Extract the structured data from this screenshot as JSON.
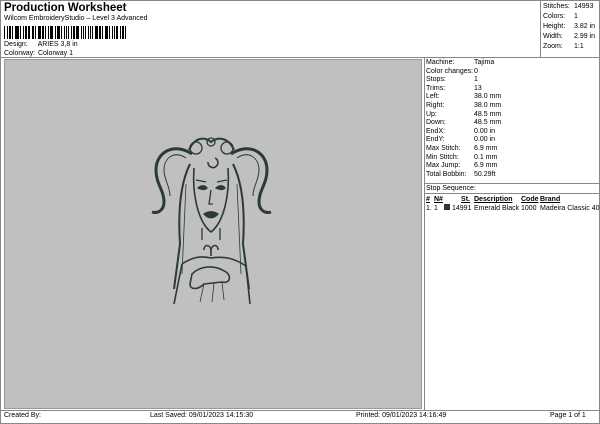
{
  "header": {
    "title": "Production Worksheet",
    "subtitle": "Wilcom EmbroideryStudio – Level 3 Advanced",
    "design_label": "Design:",
    "design_value": "ARIES 3,8 in",
    "colorway_label": "Colorway:",
    "colorway_value": "Colorway 1"
  },
  "summary": [
    {
      "label": "Stitches:",
      "value": "14993"
    },
    {
      "label": "Colors:",
      "value": "1"
    },
    {
      "label": "Height:",
      "value": "3.82 in"
    },
    {
      "label": "Width:",
      "value": "2.99 in"
    },
    {
      "label": "Zoom:",
      "value": "1:1"
    }
  ],
  "details": [
    {
      "label": "Machine:",
      "value": "Tajima"
    },
    {
      "label": "Color changes:",
      "value": "0"
    },
    {
      "label": "Stops:",
      "value": "1"
    },
    {
      "label": "Trims:",
      "value": "13"
    },
    {
      "label": "Left:",
      "value": "38.0 mm"
    },
    {
      "label": "Right:",
      "value": "38.0 mm"
    },
    {
      "label": "Up:",
      "value": "48.5 mm"
    },
    {
      "label": "Down:",
      "value": "48.5 mm"
    },
    {
      "label": "EndX:",
      "value": "0.00 in"
    },
    {
      "label": "EndY:",
      "value": "0.00 in"
    },
    {
      "label": "Max Stitch:",
      "value": "6.9 mm"
    },
    {
      "label": "Min Stitch:",
      "value": "0.1 mm"
    },
    {
      "label": "Max Jump:",
      "value": "6.9 mm"
    },
    {
      "label": "Total Bobbin:",
      "value": "50.29ft"
    }
  ],
  "stop_sequence": {
    "title": "Stop Sequence:",
    "headers": {
      "index": "#",
      "n": "N#",
      "st": "St.",
      "description": "Description",
      "code": "Code",
      "brand": "Brand"
    },
    "rows": [
      {
        "index": "1.",
        "n": "1",
        "color": "#2b3a35",
        "st": "14991",
        "description": "Emerald Black",
        "code": "1000",
        "brand": "Madeira Classic 40"
      }
    ]
  },
  "footer": {
    "created_by": "Created By:",
    "last_saved": "Last Saved: 09/01/2023 14:15:30",
    "printed": "Printed: 09/01/2023 14:16:49",
    "page": "Page 1 of 1"
  },
  "colors": {
    "canvas_bg": "#c0c0c0",
    "thread": "#2b3a35"
  },
  "icons": [
    "barcode-icon",
    "embroidery-design-image"
  ]
}
